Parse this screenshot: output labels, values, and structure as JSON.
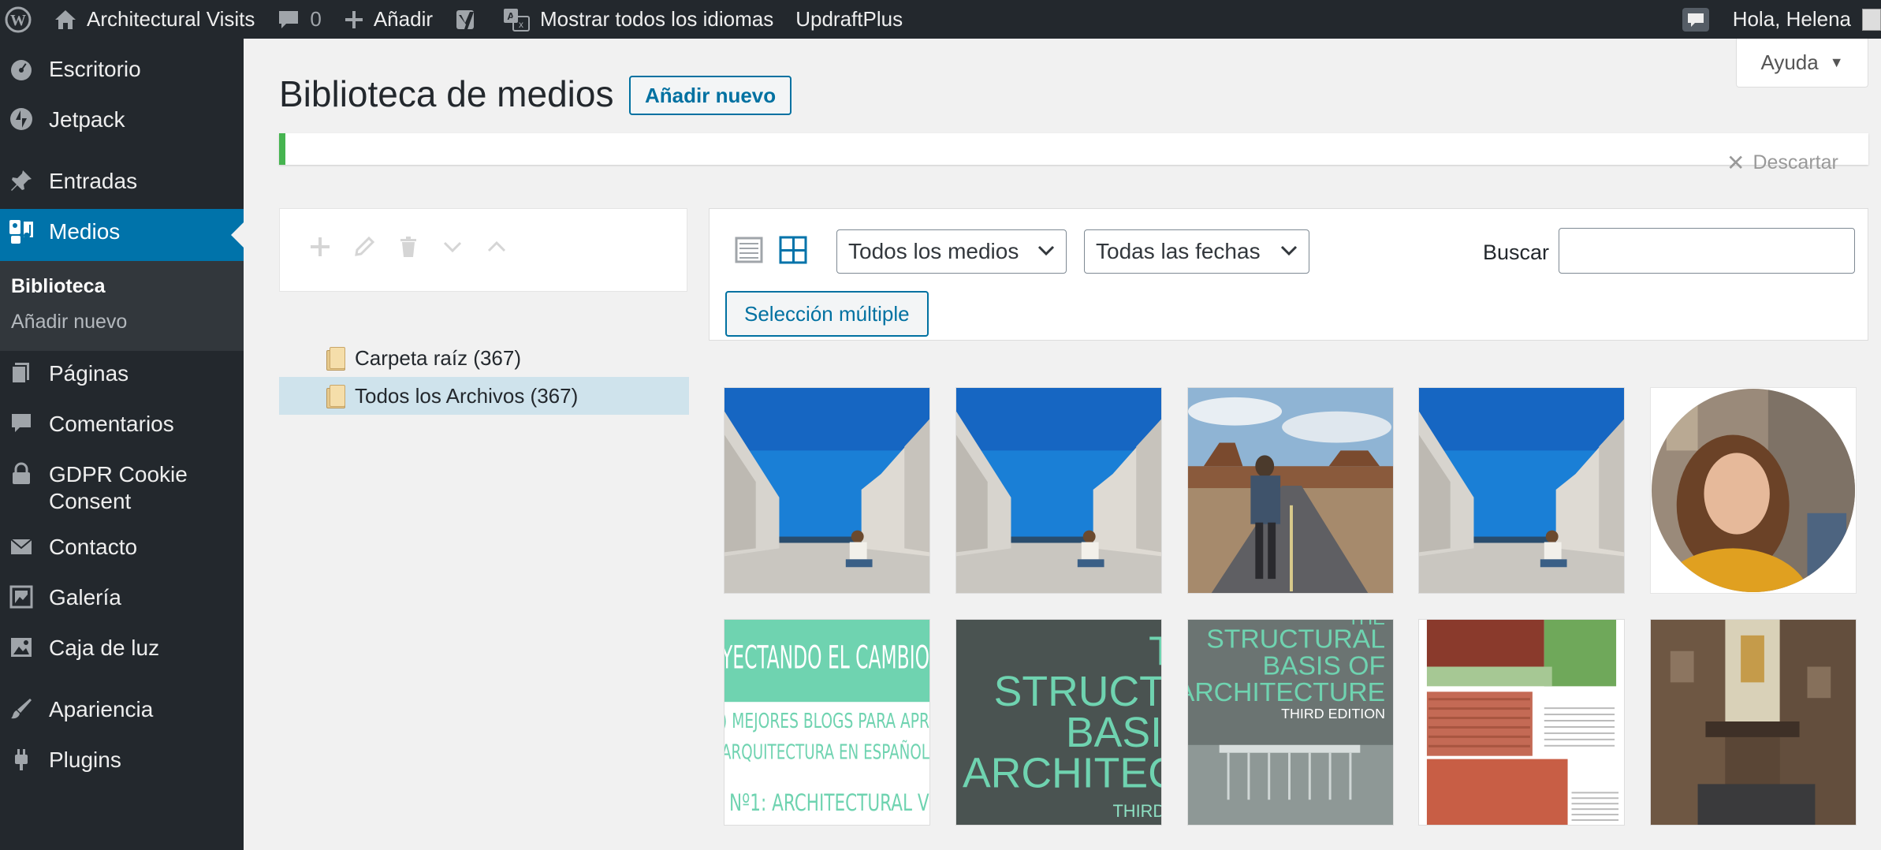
{
  "adminbar": {
    "site_name": "Architectural Visits",
    "comments_count": "0",
    "add_label": "Añadir",
    "languages_label": "Mostrar todos los idiomas",
    "updraft_label": "UpdraftPlus",
    "greeting": "Hola, Helena"
  },
  "sidebar": {
    "items": [
      {
        "label": "Escritorio",
        "icon": "dashboard-icon"
      },
      {
        "label": "Jetpack",
        "icon": "jetpack-icon"
      },
      {
        "label": "Entradas",
        "icon": "pin-icon"
      },
      {
        "label": "Medios",
        "icon": "media-icon"
      },
      {
        "label": "Páginas",
        "icon": "pages-icon"
      },
      {
        "label": "Comentarios",
        "icon": "comment-icon"
      },
      {
        "label": "GDPR Cookie Consent",
        "icon": "lock-icon"
      },
      {
        "label": "Contacto",
        "icon": "mail-icon"
      },
      {
        "label": "Galería",
        "icon": "gallery-icon"
      },
      {
        "label": "Caja de luz",
        "icon": "image-icon"
      },
      {
        "label": "Apariencia",
        "icon": "brush-icon"
      },
      {
        "label": "Plugins",
        "icon": "plugin-icon"
      }
    ],
    "submenu": {
      "current": "Biblioteca",
      "add_new": "Añadir nuevo"
    }
  },
  "help_tab": "Ayuda",
  "page": {
    "title": "Biblioteca de medios",
    "add_new_button": "Añadir nuevo",
    "dismiss": "Descartar"
  },
  "folders": [
    {
      "label": "Carpeta raíz (367)"
    },
    {
      "label": "Todos los Archivos (367)"
    }
  ],
  "toolbar": {
    "media_filter": "Todos los medios",
    "date_filter": "Todas las fechas",
    "search_label": "Buscar",
    "search_value": "",
    "bulk_select": "Selección múltiple"
  },
  "media_items": [
    {
      "kind": "photo-plaza"
    },
    {
      "kind": "photo-plaza"
    },
    {
      "kind": "photo-road"
    },
    {
      "kind": "photo-plaza"
    },
    {
      "kind": "photo-portrait"
    },
    {
      "kind": "cover-cambio",
      "text_lines": [
        "YECTANDO EL CAMBIO",
        ") MEJORES BLOGS PARA APR",
        "ARQUITECTURA EN ESPAÑOL",
        "Nº1: ARCHITECTURAL VI"
      ]
    },
    {
      "kind": "cover-structural-dark",
      "text_lines": [
        "T",
        "STRUCTUR",
        "BASIS",
        "ARCHITECTU",
        "THIRD E"
      ]
    },
    {
      "kind": "cover-structural",
      "text_lines": [
        "THE",
        "STRUCTURAL",
        "BASIS OF",
        "ARCHITECTURE",
        "THIRD EDITION"
      ]
    },
    {
      "kind": "doc-brick"
    },
    {
      "kind": "photo-street"
    }
  ]
}
